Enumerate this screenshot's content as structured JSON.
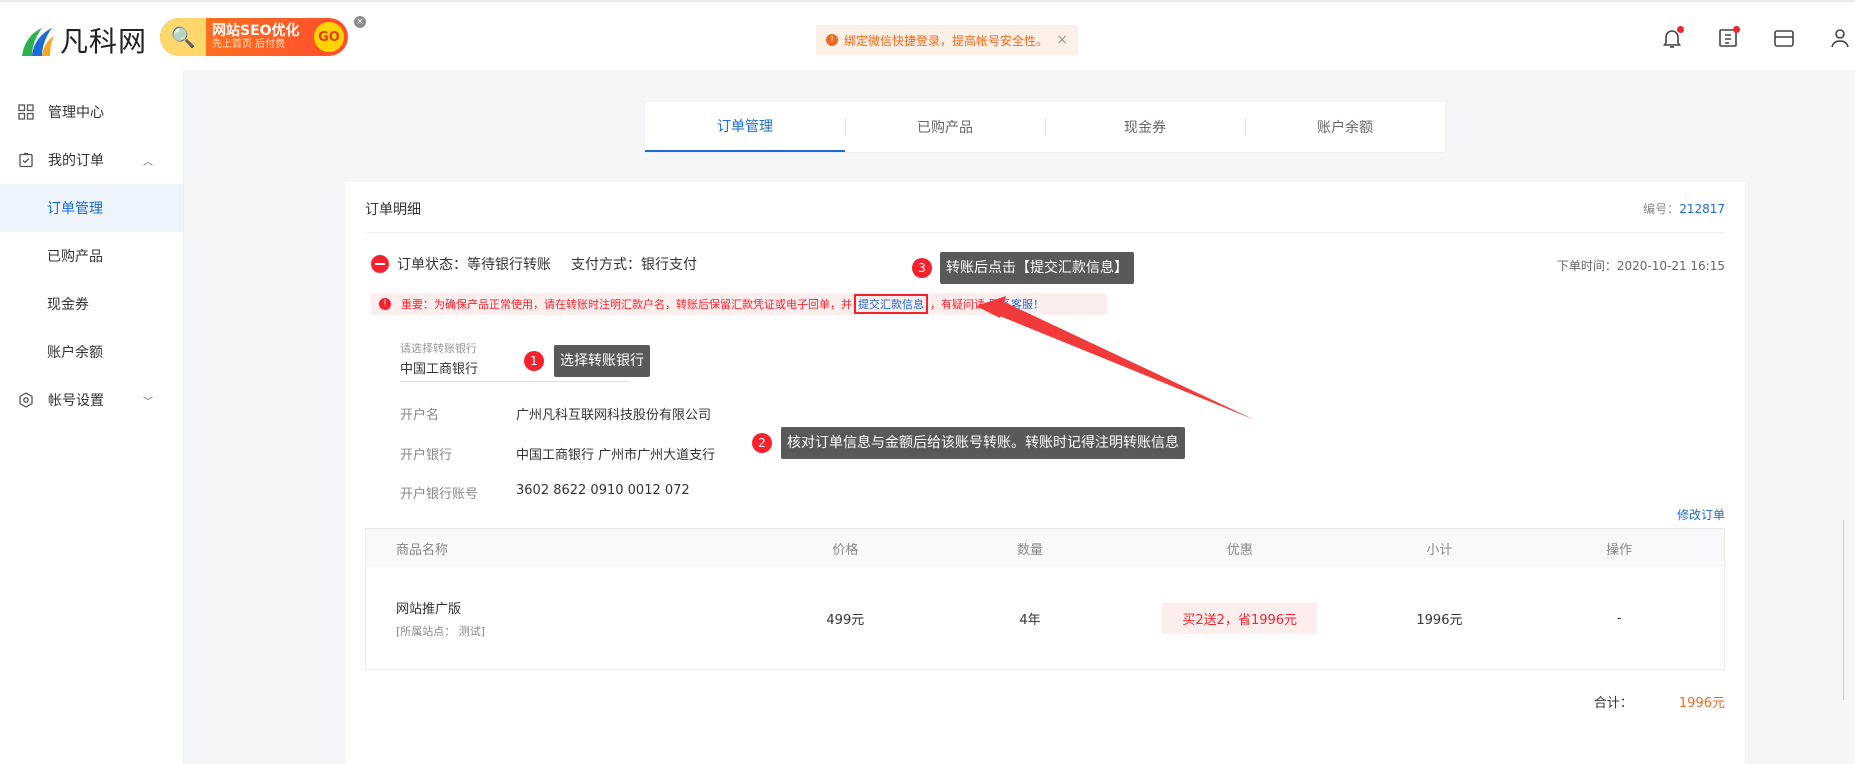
{
  "header": {
    "logo_text": "凡科网",
    "ad": {
      "title": "网站SEO优化",
      "subtitle": "先上首页 后付费",
      "go": "GO",
      "close": "×"
    },
    "notice": {
      "text": "绑定微信快捷登录，提高帐号安全性。",
      "close": "×"
    },
    "icons": [
      "bell-icon",
      "ticket-icon",
      "store-icon",
      "user-icon"
    ]
  },
  "sidebar": {
    "items": [
      {
        "label": "管理中心",
        "icon": "grid-icon"
      },
      {
        "label": "我的订单",
        "icon": "clipboard-check-icon",
        "caret": "︿"
      },
      {
        "label": "订单管理",
        "sub": true,
        "active": true
      },
      {
        "label": "已购产品",
        "sub": true
      },
      {
        "label": "现金券",
        "sub": true
      },
      {
        "label": "账户余额",
        "sub": true
      },
      {
        "label": "帐号设置",
        "icon": "settings-icon",
        "caret": "﹀"
      }
    ]
  },
  "tabs": [
    {
      "label": "订单管理",
      "active": true
    },
    {
      "label": "已购产品"
    },
    {
      "label": "现金券"
    },
    {
      "label": "账户余额"
    }
  ],
  "order": {
    "title": "订单明细",
    "number_label": "编号：",
    "number": "212817",
    "status": "订单状态：等待银行转账",
    "pay_method": "支付方式：银行支付",
    "time": "下单时间：2020-10-21 16:15",
    "warning": {
      "icon": "!",
      "text": "重要：为确保产品正常使用，请在转账时注明汇款户名，转账后保留汇款凭证或电子回单，并",
      "link": "提交汇款信息",
      "suffix": "，有疑问请",
      "service": "联系客服！"
    },
    "bank": {
      "label": "请选择转账银行",
      "value": "中国工商银行"
    },
    "info": [
      {
        "key": "开户名",
        "value": "广州凡科互联网科技股份有限公司"
      },
      {
        "key": "开户银行",
        "value": "中国工商银行 广州市广州大道支行"
      },
      {
        "key": "开户银行账号",
        "value": "3602 8622 0910 0012 072"
      }
    ],
    "edit_link": "修改订单"
  },
  "callouts": [
    {
      "num": "1",
      "text": "选择转账银行"
    },
    {
      "num": "2",
      "text": "核对订单信息与金额后给该账号转账。转账时记得注明转账信息"
    },
    {
      "num": "3",
      "text": "转账后点击【提交汇款信息】"
    }
  ],
  "table": {
    "headers": [
      "商品名称",
      "价格",
      "数量",
      "优惠",
      "小计",
      "操作"
    ],
    "rows": [
      {
        "name": "网站推广版",
        "site": "[所属站点：  测试]",
        "price": "499元",
        "qty": "4年",
        "discount": "买2送2，省1996元",
        "subtotal": "1996元",
        "action": "-"
      }
    ]
  },
  "total": {
    "label": "合计：",
    "value": "1996元"
  },
  "colors": {
    "accent": "#1a6ad8",
    "danger": "#f5222d",
    "orange": "#f06a1e"
  }
}
